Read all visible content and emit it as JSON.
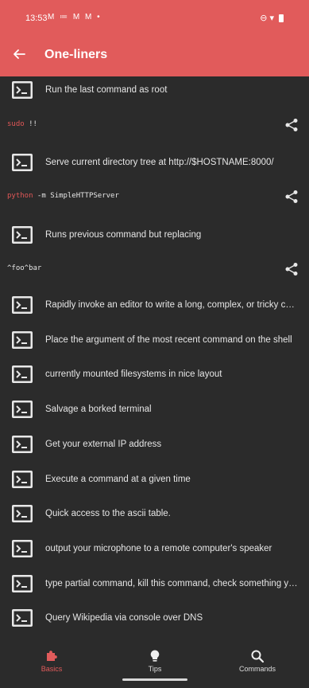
{
  "status_bar": {
    "time": "13:53",
    "left_icons": "M ≔ M M •",
    "right_icons": "⊖ ▾"
  },
  "app_bar": {
    "title": "One-liners"
  },
  "items": [
    {
      "label": "Run the last command as root",
      "code_prefix": "sudo",
      "code_rest": " !!"
    },
    {
      "label": "Serve current directory tree at http://$HOSTNAME:8000/",
      "code_prefix": "python",
      "code_rest": " -m SimpleHTTPServer"
    },
    {
      "label": "Runs previous command but replacing",
      "code_prefix": "",
      "code_rest": "^foo^bar"
    },
    {
      "label": "Rapidly invoke an editor to write a long, complex, or tricky command"
    },
    {
      "label": "Place the argument of the most recent command on the shell"
    },
    {
      "label": "currently mounted filesystems in nice layout"
    },
    {
      "label": "Salvage a borked terminal"
    },
    {
      "label": "Get your external IP address"
    },
    {
      "label": "Execute a command at a given time"
    },
    {
      "label": "Quick access to the ascii table."
    },
    {
      "label": "output your microphone to a remote computer's speaker"
    },
    {
      "label": "type partial command, kill this command, check something you for…"
    },
    {
      "label": "Query Wikipedia via console over DNS"
    }
  ],
  "nav": {
    "basics": "Basics",
    "tips": "Tips",
    "commands": "Commands"
  },
  "colors": {
    "accent": "#e15b5b",
    "background": "#2b2b2b",
    "code_keyword": "#e05757"
  }
}
